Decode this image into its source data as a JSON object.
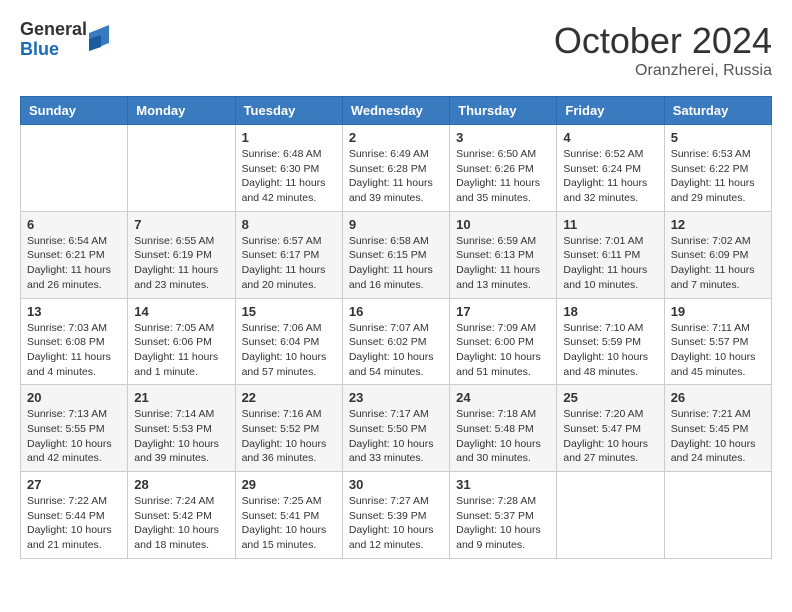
{
  "header": {
    "logo_general": "General",
    "logo_blue": "Blue",
    "month_title": "October 2024",
    "location": "Oranzherei, Russia"
  },
  "weekdays": [
    "Sunday",
    "Monday",
    "Tuesday",
    "Wednesday",
    "Thursday",
    "Friday",
    "Saturday"
  ],
  "weeks": [
    [
      {
        "day": "",
        "info": ""
      },
      {
        "day": "",
        "info": ""
      },
      {
        "day": "1",
        "info": "Sunrise: 6:48 AM\nSunset: 6:30 PM\nDaylight: 11 hours and 42 minutes."
      },
      {
        "day": "2",
        "info": "Sunrise: 6:49 AM\nSunset: 6:28 PM\nDaylight: 11 hours and 39 minutes."
      },
      {
        "day": "3",
        "info": "Sunrise: 6:50 AM\nSunset: 6:26 PM\nDaylight: 11 hours and 35 minutes."
      },
      {
        "day": "4",
        "info": "Sunrise: 6:52 AM\nSunset: 6:24 PM\nDaylight: 11 hours and 32 minutes."
      },
      {
        "day": "5",
        "info": "Sunrise: 6:53 AM\nSunset: 6:22 PM\nDaylight: 11 hours and 29 minutes."
      }
    ],
    [
      {
        "day": "6",
        "info": "Sunrise: 6:54 AM\nSunset: 6:21 PM\nDaylight: 11 hours and 26 minutes."
      },
      {
        "day": "7",
        "info": "Sunrise: 6:55 AM\nSunset: 6:19 PM\nDaylight: 11 hours and 23 minutes."
      },
      {
        "day": "8",
        "info": "Sunrise: 6:57 AM\nSunset: 6:17 PM\nDaylight: 11 hours and 20 minutes."
      },
      {
        "day": "9",
        "info": "Sunrise: 6:58 AM\nSunset: 6:15 PM\nDaylight: 11 hours and 16 minutes."
      },
      {
        "day": "10",
        "info": "Sunrise: 6:59 AM\nSunset: 6:13 PM\nDaylight: 11 hours and 13 minutes."
      },
      {
        "day": "11",
        "info": "Sunrise: 7:01 AM\nSunset: 6:11 PM\nDaylight: 11 hours and 10 minutes."
      },
      {
        "day": "12",
        "info": "Sunrise: 7:02 AM\nSunset: 6:09 PM\nDaylight: 11 hours and 7 minutes."
      }
    ],
    [
      {
        "day": "13",
        "info": "Sunrise: 7:03 AM\nSunset: 6:08 PM\nDaylight: 11 hours and 4 minutes."
      },
      {
        "day": "14",
        "info": "Sunrise: 7:05 AM\nSunset: 6:06 PM\nDaylight: 11 hours and 1 minute."
      },
      {
        "day": "15",
        "info": "Sunrise: 7:06 AM\nSunset: 6:04 PM\nDaylight: 10 hours and 57 minutes."
      },
      {
        "day": "16",
        "info": "Sunrise: 7:07 AM\nSunset: 6:02 PM\nDaylight: 10 hours and 54 minutes."
      },
      {
        "day": "17",
        "info": "Sunrise: 7:09 AM\nSunset: 6:00 PM\nDaylight: 10 hours and 51 minutes."
      },
      {
        "day": "18",
        "info": "Sunrise: 7:10 AM\nSunset: 5:59 PM\nDaylight: 10 hours and 48 minutes."
      },
      {
        "day": "19",
        "info": "Sunrise: 7:11 AM\nSunset: 5:57 PM\nDaylight: 10 hours and 45 minutes."
      }
    ],
    [
      {
        "day": "20",
        "info": "Sunrise: 7:13 AM\nSunset: 5:55 PM\nDaylight: 10 hours and 42 minutes."
      },
      {
        "day": "21",
        "info": "Sunrise: 7:14 AM\nSunset: 5:53 PM\nDaylight: 10 hours and 39 minutes."
      },
      {
        "day": "22",
        "info": "Sunrise: 7:16 AM\nSunset: 5:52 PM\nDaylight: 10 hours and 36 minutes."
      },
      {
        "day": "23",
        "info": "Sunrise: 7:17 AM\nSunset: 5:50 PM\nDaylight: 10 hours and 33 minutes."
      },
      {
        "day": "24",
        "info": "Sunrise: 7:18 AM\nSunset: 5:48 PM\nDaylight: 10 hours and 30 minutes."
      },
      {
        "day": "25",
        "info": "Sunrise: 7:20 AM\nSunset: 5:47 PM\nDaylight: 10 hours and 27 minutes."
      },
      {
        "day": "26",
        "info": "Sunrise: 7:21 AM\nSunset: 5:45 PM\nDaylight: 10 hours and 24 minutes."
      }
    ],
    [
      {
        "day": "27",
        "info": "Sunrise: 7:22 AM\nSunset: 5:44 PM\nDaylight: 10 hours and 21 minutes."
      },
      {
        "day": "28",
        "info": "Sunrise: 7:24 AM\nSunset: 5:42 PM\nDaylight: 10 hours and 18 minutes."
      },
      {
        "day": "29",
        "info": "Sunrise: 7:25 AM\nSunset: 5:41 PM\nDaylight: 10 hours and 15 minutes."
      },
      {
        "day": "30",
        "info": "Sunrise: 7:27 AM\nSunset: 5:39 PM\nDaylight: 10 hours and 12 minutes."
      },
      {
        "day": "31",
        "info": "Sunrise: 7:28 AM\nSunset: 5:37 PM\nDaylight: 10 hours and 9 minutes."
      },
      {
        "day": "",
        "info": ""
      },
      {
        "day": "",
        "info": ""
      }
    ]
  ]
}
